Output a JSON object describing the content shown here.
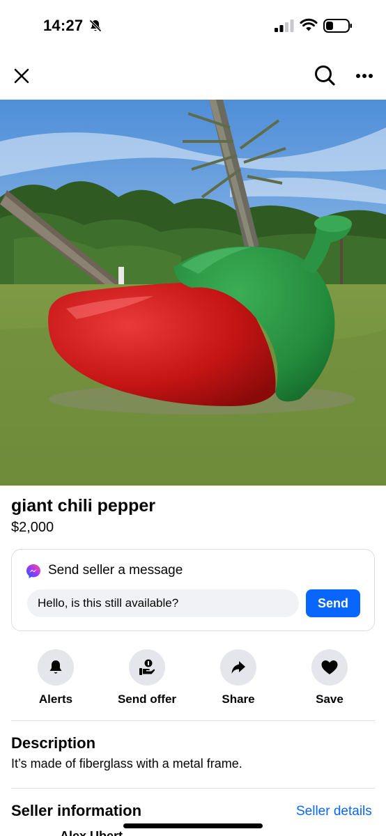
{
  "status_bar": {
    "time": "14:27",
    "icons": [
      "bell-slash-icon",
      "cellular-signal-icon",
      "wifi-icon",
      "battery-icon"
    ]
  },
  "nav": {
    "icons": [
      "close-icon",
      "search-icon",
      "more-dots-icon"
    ]
  },
  "listing": {
    "title": "giant chili pepper",
    "price": "$2,000"
  },
  "message": {
    "heading": "Send seller a message",
    "input_value": "Hello, is this still available?",
    "send_label": "Send"
  },
  "actions": [
    {
      "label": "Alerts",
      "icon": "bell-icon"
    },
    {
      "label": "Send offer",
      "icon": "offer-hand-icon"
    },
    {
      "label": "Share",
      "icon": "share-arrow-icon"
    },
    {
      "label": "Save",
      "icon": "heart-icon"
    }
  ],
  "description": {
    "heading": "Description",
    "text": "It’s made of fiberglass with a metal frame."
  },
  "seller": {
    "heading": "Seller information",
    "details_link": "Seller details",
    "name_peek": "Alex Ubert"
  },
  "colors": {
    "accent": "#0866ff",
    "input_bg": "#f0f2f5",
    "action_circle_bg": "#e4e6eb",
    "divider": "#dadde1"
  }
}
